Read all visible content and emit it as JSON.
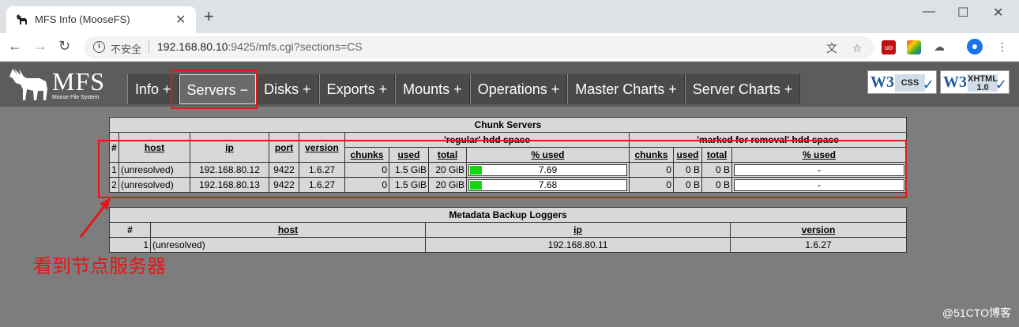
{
  "browser": {
    "tab_title": "MFS Info (MooseFS)",
    "insecure_label": "不安全",
    "url_host": "192.168.80.10",
    "url_rest": ":9425/mfs.cgi?sections=CS"
  },
  "logo": {
    "title": "MFS",
    "subtitle": "Moose File System"
  },
  "menu": [
    {
      "label": "Info +"
    },
    {
      "label": "Servers −"
    },
    {
      "label": "Disks +"
    },
    {
      "label": "Exports +"
    },
    {
      "label": "Mounts +"
    },
    {
      "label": "Operations +"
    },
    {
      "label": "Master Charts +"
    },
    {
      "label": "Server Charts +"
    }
  ],
  "badges": {
    "css": "CSS",
    "xhtml": "XHTML",
    "xhtml_ver": "1.0",
    "w3c": "W3C"
  },
  "chunk_servers": {
    "title": "Chunk Servers",
    "group_regular": "'regular' hdd space",
    "group_removal": "'marked for removal' hdd space",
    "col_num": "#",
    "col_host": "host",
    "col_ip": "ip",
    "col_port": "port",
    "col_version": "version",
    "col_chunks": "chunks",
    "col_used": "used",
    "col_total": "total",
    "col_pct": "% used",
    "rows": [
      {
        "num": "1",
        "host": "(unresolved)",
        "ip": "192.168.80.12",
        "port": "9422",
        "version": "1.6.27",
        "chunks": "0",
        "used": "1.5 GiB",
        "total": "20 GiB",
        "pct": "7.69",
        "pct_value": 7.69,
        "r_chunks": "0",
        "r_used": "0 B",
        "r_total": "0 B",
        "r_pct": "-"
      },
      {
        "num": "2",
        "host": "(unresolved)",
        "ip": "192.168.80.13",
        "port": "9422",
        "version": "1.6.27",
        "chunks": "0",
        "used": "1.5 GiB",
        "total": "20 GiB",
        "pct": "7.68",
        "pct_value": 7.68,
        "r_chunks": "0",
        "r_used": "0 B",
        "r_total": "0 B",
        "r_pct": "-"
      }
    ]
  },
  "backup_loggers": {
    "title": "Metadata Backup Loggers",
    "col_num": "#",
    "col_host": "host",
    "col_ip": "ip",
    "col_version": "version",
    "rows": [
      {
        "num": "1",
        "host": "(unresolved)",
        "ip": "192.168.80.11",
        "version": "1.6.27"
      }
    ]
  },
  "annotation": "看到节点服务器",
  "watermark": "@51CTO博客",
  "colors": {
    "annotation": "#e01818",
    "bar": "#11d611",
    "page_bg": "#7d7d7d"
  }
}
